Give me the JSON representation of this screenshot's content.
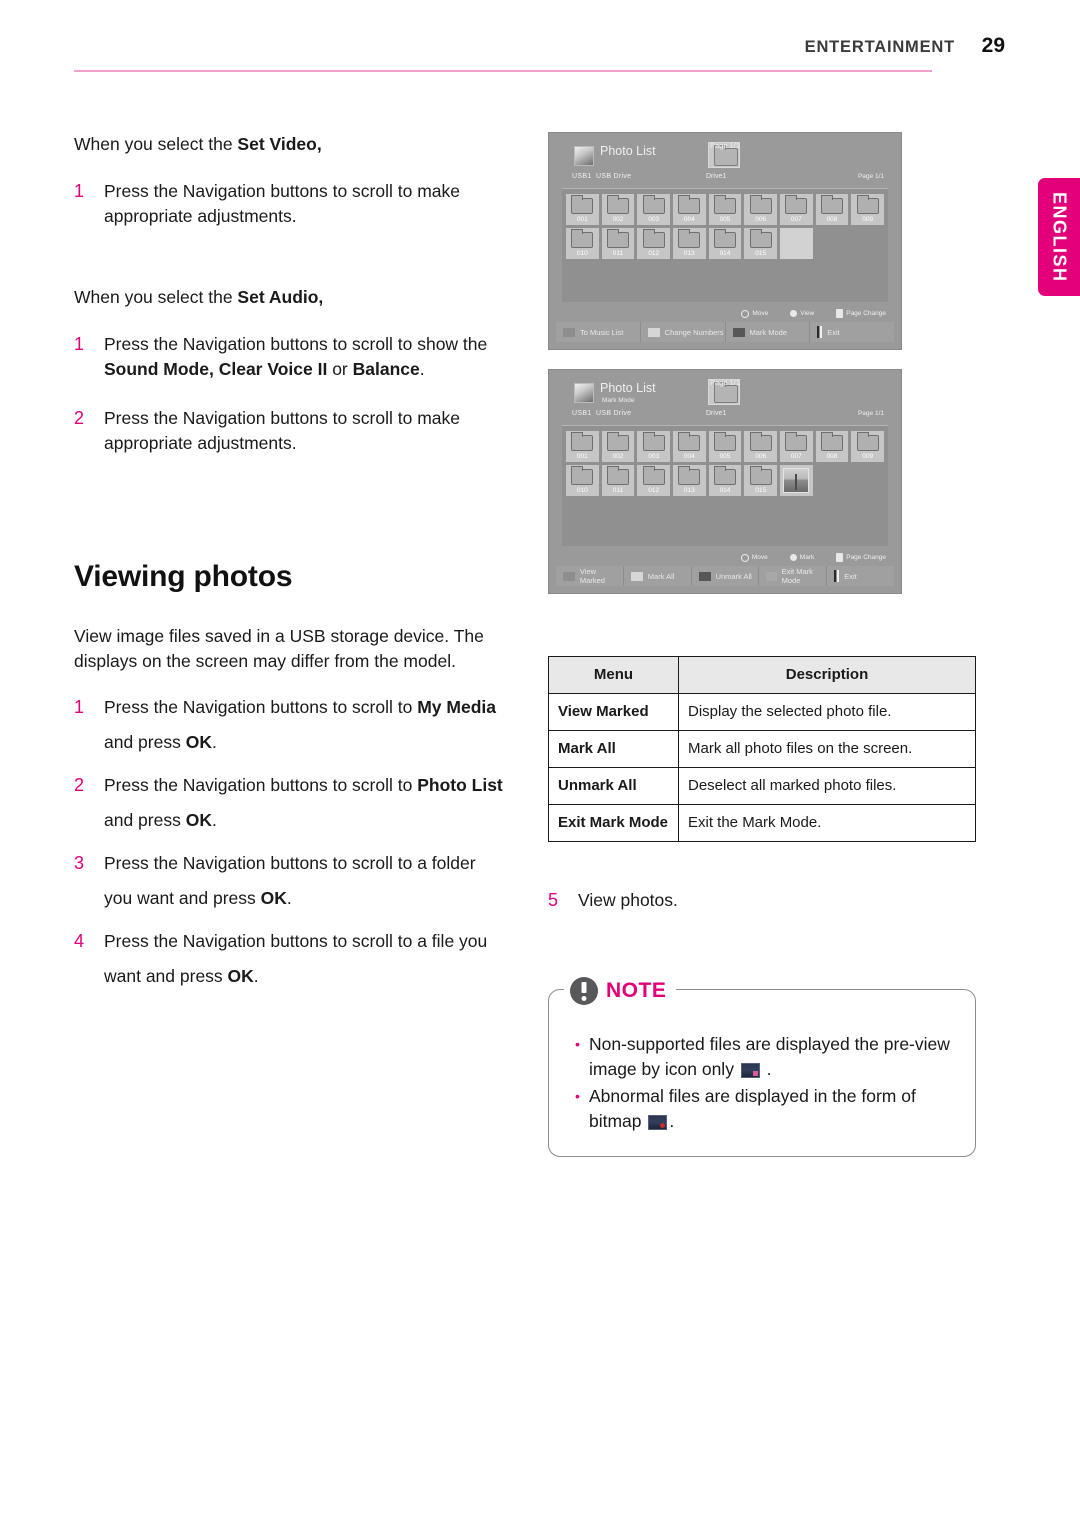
{
  "header": {
    "title": "ENTERTAINMENT",
    "page_number": "29",
    "rule_color": "#f2a0cd"
  },
  "lang_tab": {
    "label": "ENGLISH",
    "color": "#e2007a"
  },
  "left_column": {
    "intro_video": {
      "prefix": "When you select the ",
      "bold": "Set Video,",
      "suffix": ""
    },
    "video_steps": [
      {
        "num": "1",
        "text": "Press the Navigation buttons to scroll to make appropriate adjustments."
      }
    ],
    "intro_audio": {
      "prefix": "When you select the ",
      "bold": "Set Audio,",
      "suffix": ""
    },
    "audio_steps": [
      {
        "num": "1",
        "text_parts": [
          "Press the Navigation buttons to scroll to show the ",
          "Sound Mode, Clear Voice II",
          " or ",
          "Balance",
          "."
        ]
      },
      {
        "num": "2",
        "text": "Press the Navigation buttons to scroll to make appropriate adjustments."
      }
    ],
    "section_title": "Viewing photos",
    "section_intro": "View image files saved in a USB storage device. The displays on the screen may differ from the model.",
    "photo_steps": [
      {
        "num": "1",
        "p1": "Press the Navigation buttons to scroll to ",
        "b1": "My Media",
        "p2": " and press ",
        "b2": "OK",
        "p3": "."
      },
      {
        "num": "2",
        "p1": "Press the Navigation buttons to scroll to ",
        "b1": "Photo List",
        "p2": " and press ",
        "b2": "OK",
        "p3": "."
      },
      {
        "num": "3",
        "p1": "Press the Navigation buttons to scroll to a folder you want and press ",
        "b1": "OK",
        "p2": ".",
        "b2": "",
        "p3": ""
      },
      {
        "num": "4",
        "p1": "Press the Navigation buttons to scroll to a file you want and press ",
        "b1": "OK",
        "p2": ".",
        "b2": "",
        "p3": ""
      }
    ]
  },
  "screenshot_1": {
    "app_title": "Photo List",
    "sub_mode": "",
    "usb_label": "USB1",
    "usb_drive": "USB Drive",
    "drive_label": "Drive1",
    "page_top": "Page 1/1",
    "page_right": "Page 1/1",
    "cells": [
      {
        "label": "001",
        "type": "folder"
      },
      {
        "label": "002",
        "type": "folder"
      },
      {
        "label": "003",
        "type": "folder"
      },
      {
        "label": "004",
        "type": "folder"
      },
      {
        "label": "005",
        "type": "folder"
      },
      {
        "label": "006",
        "type": "folder"
      },
      {
        "label": "007",
        "type": "folder"
      },
      {
        "label": "008",
        "type": "folder"
      },
      {
        "label": "009",
        "type": "folder"
      },
      {
        "label": "010",
        "type": "folder"
      },
      {
        "label": "011",
        "type": "folder"
      },
      {
        "label": "012",
        "type": "folder"
      },
      {
        "label": "013",
        "type": "folder"
      },
      {
        "label": "014",
        "type": "folder"
      },
      {
        "label": "015",
        "type": "folder"
      },
      {
        "label": "",
        "type": "empty"
      }
    ],
    "hints": [
      {
        "icon": "dpad-icon",
        "label": "Move"
      },
      {
        "icon": "ok-icon",
        "label": "View"
      },
      {
        "icon": "page-icon",
        "label": "Page Change"
      }
    ],
    "buttons": [
      {
        "color": "red",
        "label": "To Music List"
      },
      {
        "color": "green",
        "label": "Change Numbers"
      },
      {
        "color": "yellow",
        "label": "Mark Mode"
      },
      {
        "color": "exit",
        "label": "Exit"
      }
    ]
  },
  "screenshot_2": {
    "app_title": "Photo List",
    "sub_mode": "Mark Mode",
    "usb_label": "USB1",
    "usb_drive": "USB Drive",
    "drive_label": "Drive1",
    "page_top": "Page 1/1",
    "page_right": "Page 1/1",
    "cells": [
      {
        "label": "001",
        "type": "folder"
      },
      {
        "label": "002",
        "type": "folder"
      },
      {
        "label": "003",
        "type": "folder"
      },
      {
        "label": "004",
        "type": "folder"
      },
      {
        "label": "005",
        "type": "folder"
      },
      {
        "label": "006",
        "type": "folder"
      },
      {
        "label": "007",
        "type": "folder"
      },
      {
        "label": "008",
        "type": "folder"
      },
      {
        "label": "009",
        "type": "folder"
      },
      {
        "label": "010",
        "type": "folder"
      },
      {
        "label": "011",
        "type": "folder"
      },
      {
        "label": "012",
        "type": "folder"
      },
      {
        "label": "013",
        "type": "folder"
      },
      {
        "label": "014",
        "type": "folder"
      },
      {
        "label": "015",
        "type": "folder"
      },
      {
        "label": "",
        "type": "photo"
      }
    ],
    "hints": [
      {
        "icon": "dpad-icon",
        "label": "Move"
      },
      {
        "icon": "ok-icon",
        "label": "Mark"
      },
      {
        "icon": "page-icon",
        "label": "Page Change"
      }
    ],
    "buttons": [
      {
        "color": "red",
        "label": "View Marked"
      },
      {
        "color": "green",
        "label": "Mark All"
      },
      {
        "color": "yellow",
        "label": "Unmark All"
      },
      {
        "color": "blue",
        "label": "Exit Mark Mode"
      },
      {
        "color": "exit",
        "label": "Exit"
      }
    ]
  },
  "menu_table": {
    "headers": [
      "Menu",
      "Description"
    ],
    "rows": [
      [
        "View Marked",
        "Display the selected photo file."
      ],
      [
        "Mark All",
        "Mark all photo files on the screen."
      ],
      [
        "Unmark All",
        "Deselect all marked photo files."
      ],
      [
        "Exit Mark Mode",
        "Exit the Mark Mode."
      ]
    ]
  },
  "right_step": {
    "num": "5",
    "text": "View photos."
  },
  "note": {
    "label": "NOTE",
    "items": [
      {
        "pre": "Non-supported files are displayed the pre-view image by icon only ",
        "post": " .",
        "thumb": "preview-thumb",
        "marker": "warning"
      },
      {
        "pre": "Abnormal files are displayed in the form of bitmap ",
        "post": ".",
        "thumb": "bitmap-thumb",
        "marker": "error"
      }
    ]
  }
}
